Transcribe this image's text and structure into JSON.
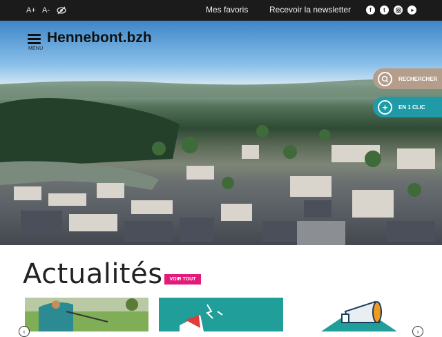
{
  "topbar": {
    "font_increase": "A+",
    "font_decrease": "A-",
    "favorites": "Mes favoris",
    "newsletter": "Recevoir la newsletter",
    "social": [
      "facebook",
      "twitter",
      "instagram",
      "youtube"
    ]
  },
  "header": {
    "menu_label": "MENU",
    "site_title": "Hennebont.bzh"
  },
  "side_actions": {
    "search": "RECHERCHER",
    "one_click": "EN 1 CLIC"
  },
  "news": {
    "title": "Actualités",
    "see_all": "VOIR TOUT"
  },
  "colors": {
    "topbar": "#1b1b1b",
    "search_pill": "#b49d8a",
    "one_click_pill": "#1f9aa6",
    "see_all": "#e5197a",
    "card_teal": "#1f9e9a"
  }
}
